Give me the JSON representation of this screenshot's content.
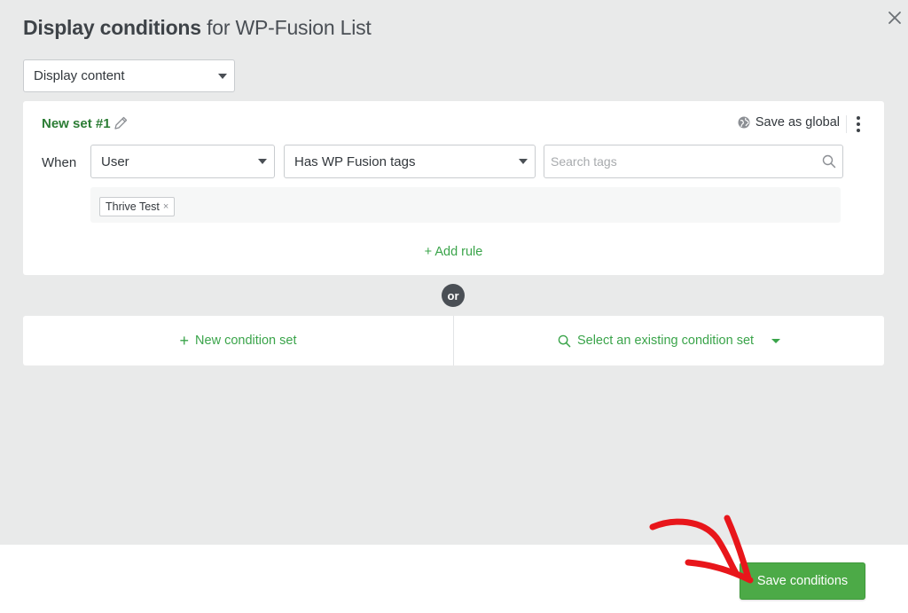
{
  "header": {
    "title_bold": "Display conditions",
    "title_rest": " for WP-Fusion List"
  },
  "display_select": {
    "value": "Display content"
  },
  "condition_set": {
    "name": "New set #1",
    "save_as_global": "Save as global",
    "rule": {
      "when_label": "When",
      "subject": "User",
      "operator": "Has WP Fusion tags",
      "search_placeholder": "Search tags",
      "tags": [
        "Thrive Test"
      ],
      "tag_remove": "×"
    },
    "add_rule": "+ Add rule"
  },
  "separator": "or",
  "actions": {
    "new_condition_set": "New condition set",
    "new_condition_set_icon": "+",
    "select_existing": "Select an existing condition set"
  },
  "footer": {
    "save_button": "Save conditions"
  },
  "colors": {
    "accent_green": "#3aa44a",
    "button_green": "#4caa47",
    "annotation_red": "#e8161b"
  }
}
